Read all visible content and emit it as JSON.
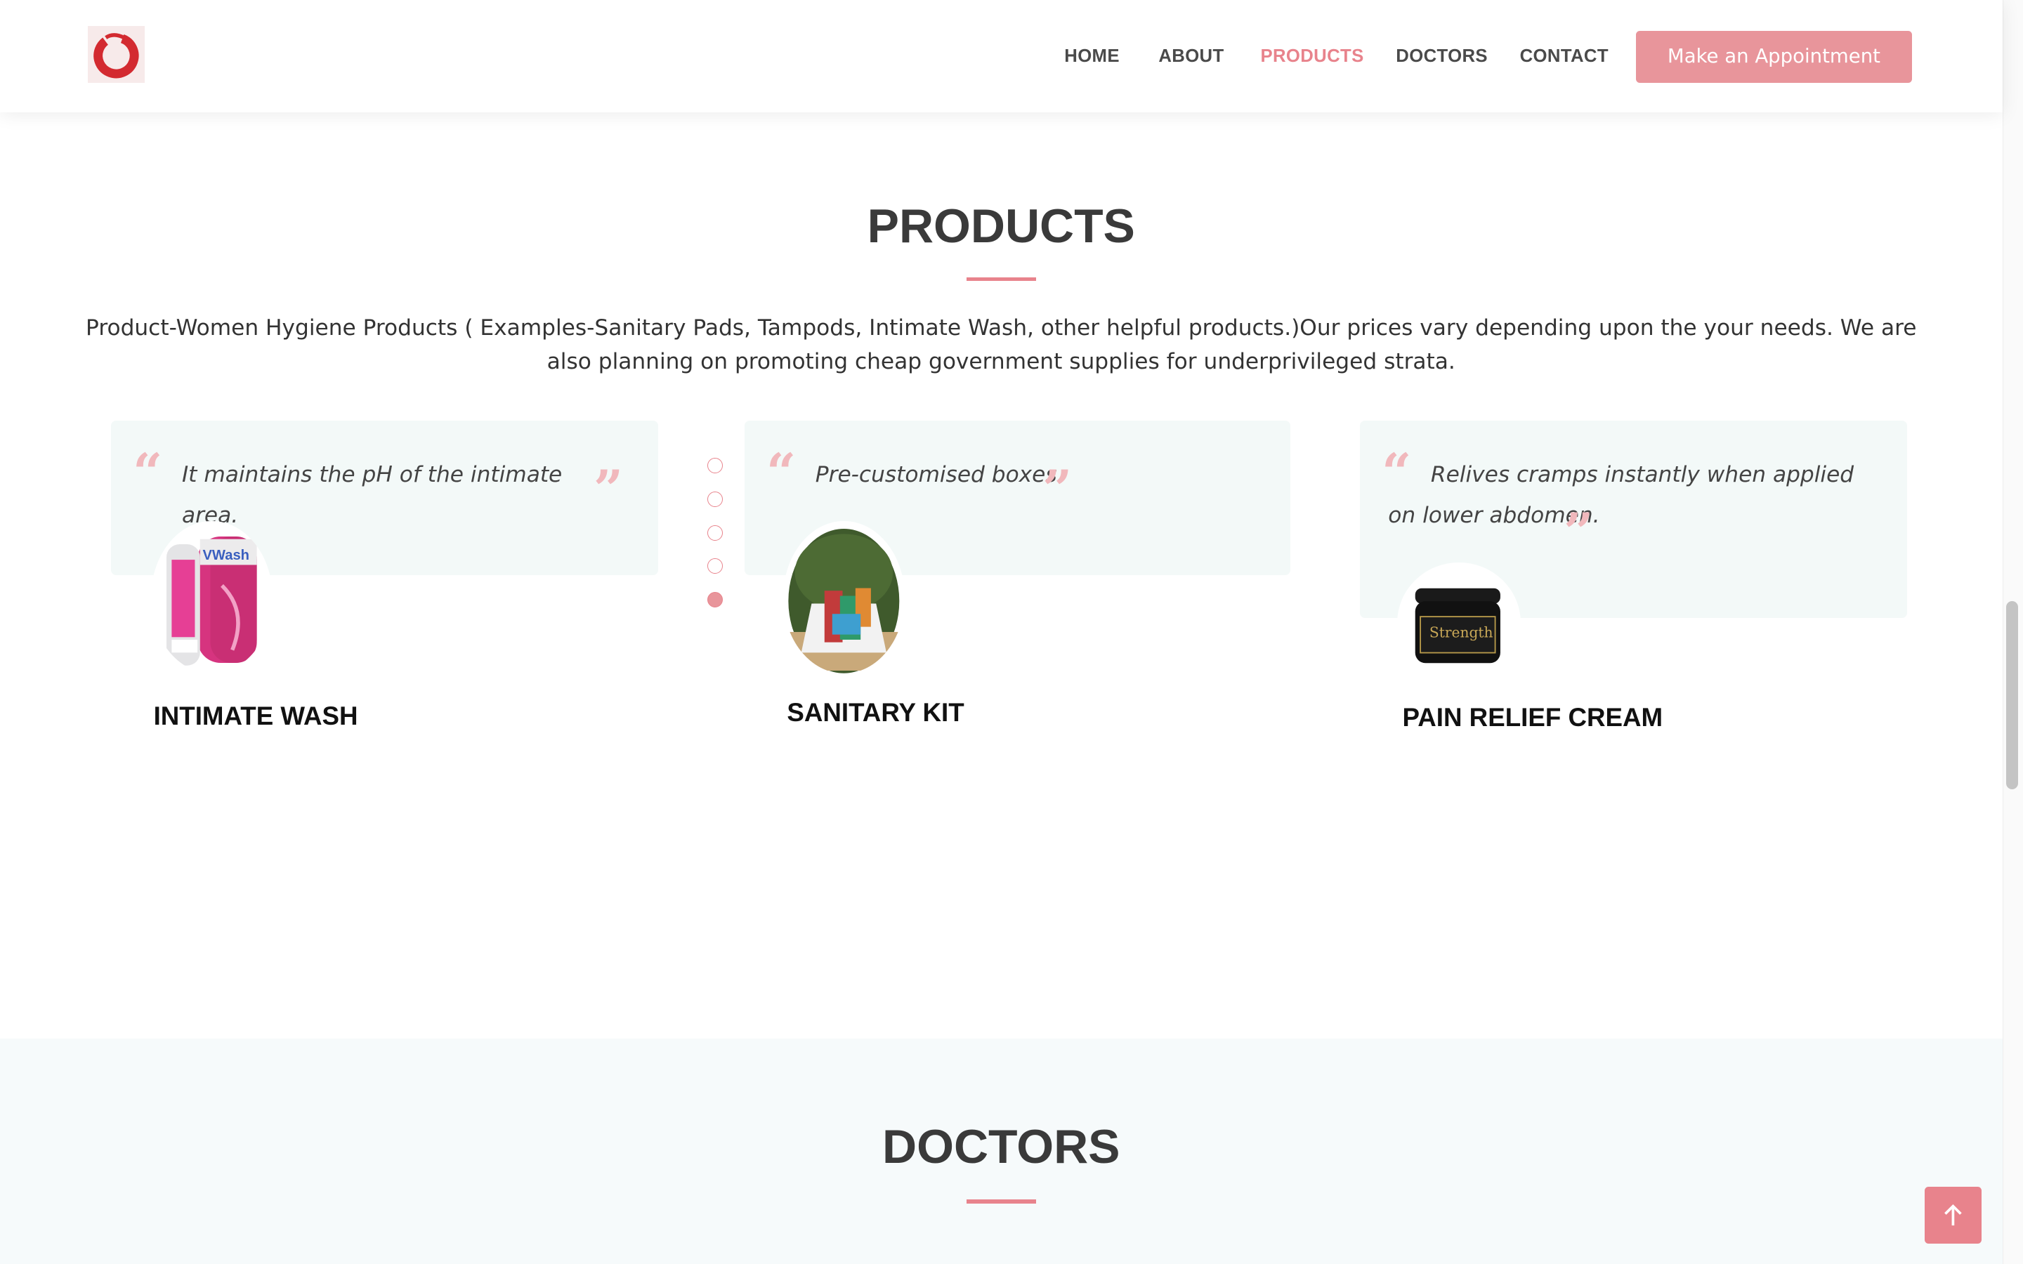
{
  "nav": {
    "items": [
      {
        "label": "HOME",
        "active": false
      },
      {
        "label": "ABOUT",
        "active": false
      },
      {
        "label": "PRODUCTS",
        "active": true
      },
      {
        "label": "DOCTORS",
        "active": false
      },
      {
        "label": "CONTACT",
        "active": false
      }
    ],
    "cta_label": "Make an Appointment"
  },
  "products": {
    "title": "PRODUCTS",
    "description": "Product-Women Hygiene Products ( Examples-Sanitary Pads, Tampods, Intimate Wash, other helpful products.)Our prices vary depending upon the your needs. We are also planning on promoting cheap government supplies for underprivileged strata.",
    "items": [
      {
        "quote": "It maintains the pH of the intimate area.",
        "name": "INTIMATE WASH",
        "image_icon": "intimate-wash-bottle"
      },
      {
        "quote": "Pre-customised boxes",
        "name": "SANITARY KIT",
        "image_icon": "sanitary-kit-box"
      },
      {
        "quote": "Relives cramps instantly when applied on lower abdomen.",
        "name": "PAIN RELIEF CREAM",
        "image_icon": "pain-relief-cream-jar"
      }
    ],
    "carousel": {
      "count": 5,
      "active_index": 4
    },
    "image_labels": {
      "wash_brand": "VWash",
      "cream_brand": "Strength"
    }
  },
  "doctors": {
    "title": "DOCTORS"
  },
  "colors": {
    "accent": "#e8838c",
    "button": "#e8959b",
    "card_bg": "#f3f9f8",
    "quote": "#f1b8bc"
  }
}
